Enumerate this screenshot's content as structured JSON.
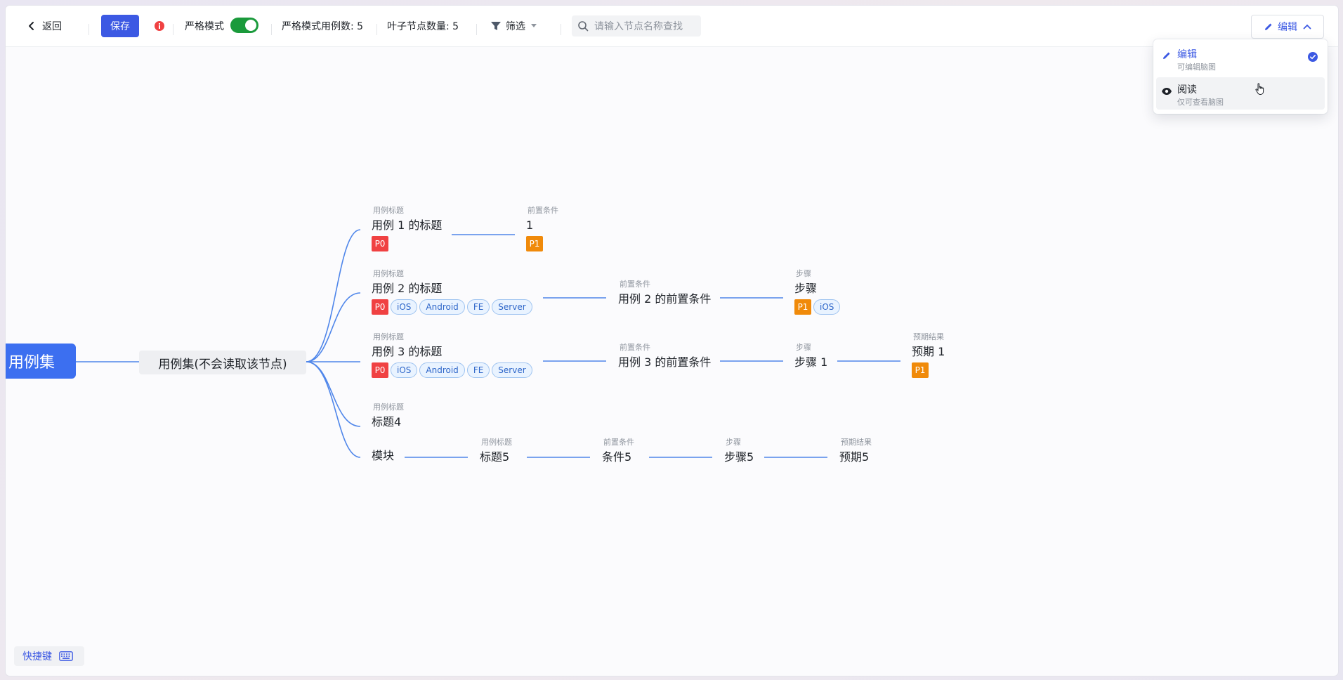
{
  "toolbar": {
    "back_label": "返回",
    "save_label": "保存",
    "strict_label": "严格模式",
    "strict_enabled": true,
    "strict_count_text": "严格模式用例数: 5",
    "leaf_count_text": "叶子节点数量: 5",
    "filter_label": "筛选",
    "search_placeholder": "请输入节点名称查找",
    "mode_label": "编辑"
  },
  "mode_menu": {
    "items": [
      {
        "label": "编辑",
        "desc": "可编辑脑图",
        "selected": true
      },
      {
        "label": "阅读",
        "desc": "仅可查看脑图",
        "selected": false
      }
    ]
  },
  "mindmap": {
    "root": "用例集",
    "level1": "用例集(不会读取该节点)",
    "branches": [
      {
        "case": {
          "label": "用例标题",
          "title": "用例 1 的标题",
          "priority": "P0",
          "tags": []
        },
        "precondition": {
          "label": "前置条件",
          "text": "1",
          "priority": "P1"
        }
      },
      {
        "case": {
          "label": "用例标题",
          "title": "用例 2 的标题",
          "priority": "P0",
          "tags": [
            "iOS",
            "Android",
            "FE",
            "Server"
          ]
        },
        "precondition": {
          "label": "前置条件",
          "text": "用例 2 的前置条件"
        },
        "step": {
          "label": "步骤",
          "text": "步骤",
          "priority": "P1",
          "tags": [
            "iOS"
          ]
        }
      },
      {
        "case": {
          "label": "用例标题",
          "title": "用例 3 的标题",
          "priority": "P0",
          "tags": [
            "iOS",
            "Android",
            "FE",
            "Server"
          ]
        },
        "precondition": {
          "label": "前置条件",
          "text": "用例 3 的前置条件"
        },
        "step": {
          "label": "步骤",
          "text": "步骤 1"
        },
        "result": {
          "label": "预期结果",
          "text": "预期 1",
          "priority": "P1"
        }
      },
      {
        "case": {
          "label": "用例标题",
          "title": "标题4"
        }
      },
      {
        "module": {
          "text": "模块"
        },
        "case": {
          "label": "用例标题",
          "title": "标题5"
        },
        "precondition": {
          "label": "前置条件",
          "text": "条件5"
        },
        "step": {
          "label": "步骤",
          "text": "步骤5"
        },
        "result": {
          "label": "预期结果",
          "text": "预期5"
        }
      }
    ]
  },
  "shortcut_label": "快捷键",
  "colors": {
    "accent": "#3c59e3",
    "root_bg": "#3c6ff0",
    "edge": "#4f86ea",
    "p0": "#f04142",
    "p1": "#f08a0a",
    "toggle_on": "#1a9a3b"
  }
}
